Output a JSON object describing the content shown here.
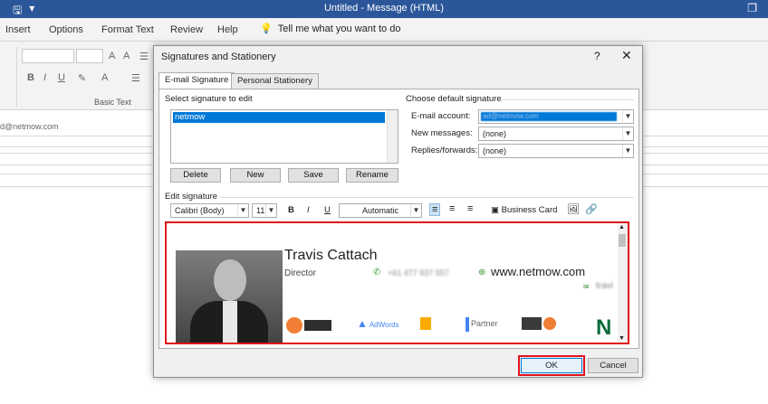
{
  "window": {
    "title": "Untitled  -  Message (HTML)"
  },
  "menu": {
    "insert": "Insert",
    "options": "Options",
    "format_text": "Format Text",
    "review": "Review",
    "help": "Help",
    "tell_me": "Tell me what you want to do"
  },
  "ribbon": {
    "basic_text_label": "Basic Text"
  },
  "compose": {
    "from_fragment": "d@netmow.com"
  },
  "dialog": {
    "title": "Signatures and Stationery",
    "help": "?",
    "tabs": [
      "E-mail Signature",
      "Personal Stationery"
    ],
    "select_label": "Select signature to edit",
    "signatures": [
      "netmow"
    ],
    "buttons": {
      "delete": "Delete",
      "new": "New",
      "save": "Save",
      "rename": "Rename"
    },
    "default_sig": {
      "heading": "Choose default signature",
      "email_account_label": "E-mail account:",
      "email_account_value": "ad@netmow.com",
      "new_messages_label": "New messages:",
      "new_messages_value": "(none)",
      "replies_label": "Replies/forwards:",
      "replies_value": "(none)"
    },
    "edit_label": "Edit signature",
    "toolbar": {
      "font": "Calibri (Body)",
      "size": "11",
      "bold": "B",
      "italic": "I",
      "underline": "U",
      "color": "Automatic",
      "business_card": "Business Card"
    },
    "signature": {
      "name": "Travis Cattach",
      "role": "Director",
      "phone": "+61 477 937 557",
      "website": "www.netmow.com",
      "email_fragment": "travi",
      "badges": [
        "HubSpot Academy INBOUND MARKETING CERTIFIED",
        "AdWords CERTIFIED",
        "Google Analytics",
        "Google Partner",
        "HubSpot Agency",
        "N"
      ]
    },
    "ok": "OK",
    "cancel": "Cancel"
  },
  "colors": {
    "titlebar": "#2b579a",
    "selection": "#0078d7",
    "highlight_border": "#e0121b",
    "icon_green": "#3a9a3a"
  }
}
